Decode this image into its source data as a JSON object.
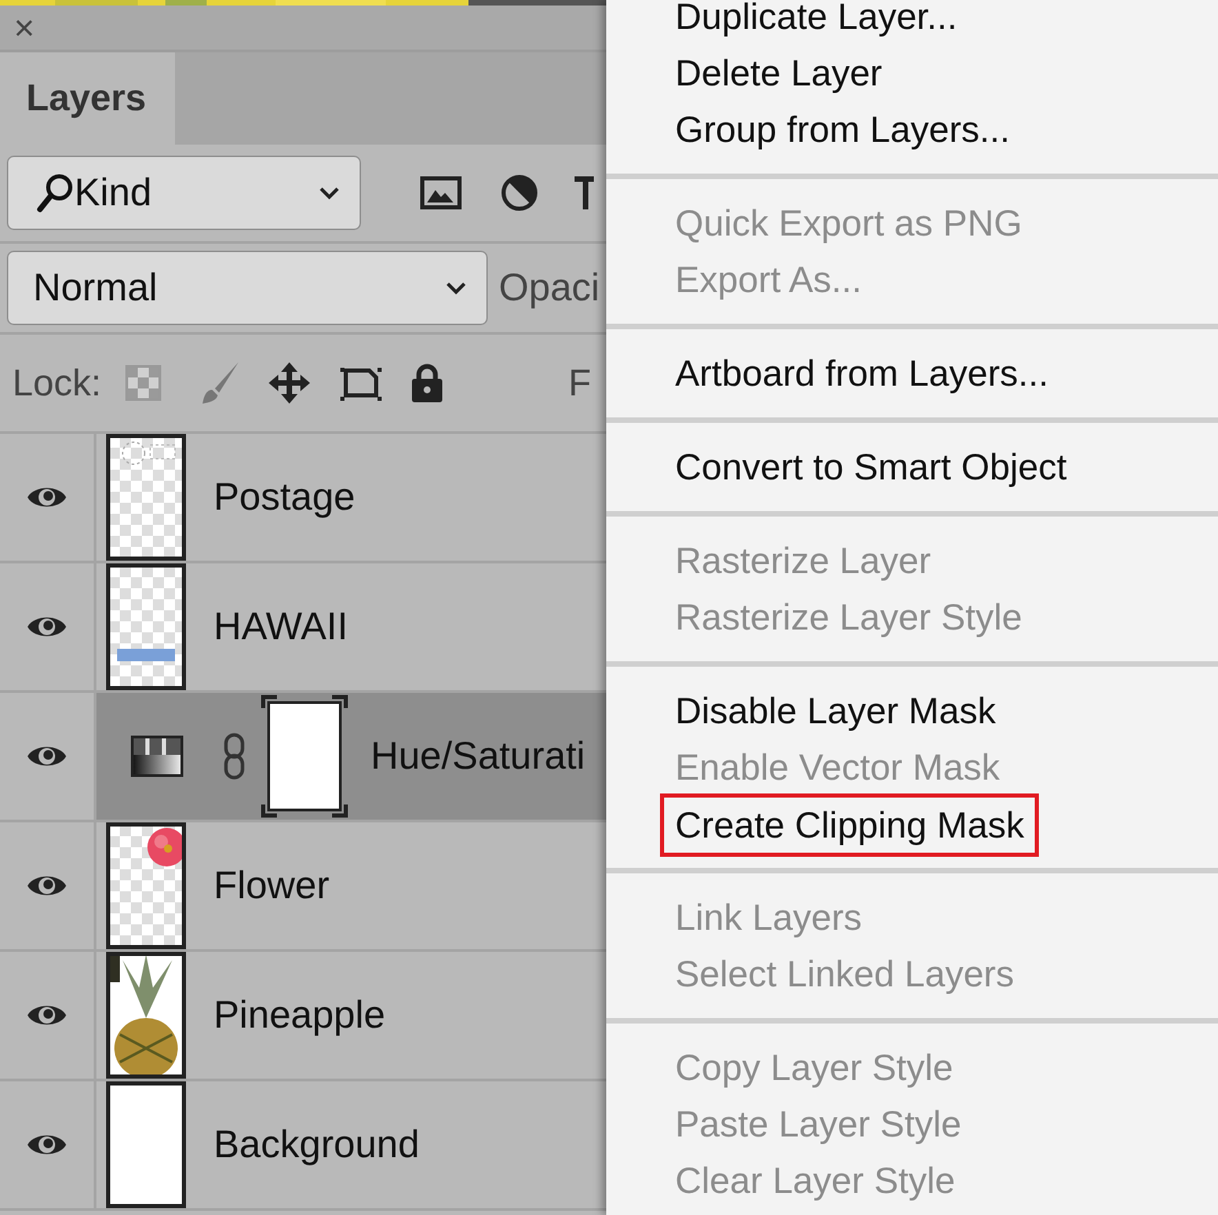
{
  "panel": {
    "close": "×",
    "tab": {
      "label": "Layers",
      "selected": true
    },
    "filter": {
      "value": "Kind"
    },
    "blend_mode": {
      "value": "Normal"
    },
    "opacity_label": "Opaci",
    "lock_label": "Lock:",
    "fill_label": "F"
  },
  "layers": [
    {
      "name": "Postage",
      "visible": true,
      "selected": false,
      "kind": "pixel"
    },
    {
      "name": "HAWAII",
      "visible": true,
      "selected": false,
      "kind": "pixel"
    },
    {
      "name": "Hue/Saturati",
      "visible": true,
      "selected": true,
      "kind": "adjustment"
    },
    {
      "name": "Flower",
      "visible": true,
      "selected": false,
      "kind": "pixel"
    },
    {
      "name": "Pineapple",
      "visible": true,
      "selected": false,
      "kind": "pixel"
    },
    {
      "name": "Background",
      "visible": true,
      "selected": false,
      "kind": "pixel"
    }
  ],
  "context_menu": {
    "groups": [
      [
        {
          "label": "Duplicate Layer...",
          "disabled": false,
          "highlighted": false
        },
        {
          "label": "Delete Layer",
          "disabled": false,
          "highlighted": false
        },
        {
          "label": "Group from Layers...",
          "disabled": false,
          "highlighted": false
        }
      ],
      [
        {
          "label": "Quick Export as PNG",
          "disabled": true,
          "highlighted": false
        },
        {
          "label": "Export As...",
          "disabled": true,
          "highlighted": false
        }
      ],
      [
        {
          "label": "Artboard from Layers...",
          "disabled": false,
          "highlighted": false
        }
      ],
      [
        {
          "label": "Convert to Smart Object",
          "disabled": false,
          "highlighted": false
        }
      ],
      [
        {
          "label": "Rasterize Layer",
          "disabled": true,
          "highlighted": false
        },
        {
          "label": "Rasterize Layer Style",
          "disabled": true,
          "highlighted": false
        }
      ],
      [
        {
          "label": "Disable Layer Mask",
          "disabled": false,
          "highlighted": false
        },
        {
          "label": "Enable Vector Mask",
          "disabled": true,
          "highlighted": false
        },
        {
          "label": "Create Clipping Mask",
          "disabled": false,
          "highlighted": true
        }
      ],
      [
        {
          "label": "Link Layers",
          "disabled": true,
          "highlighted": false
        },
        {
          "label": "Select Linked Layers",
          "disabled": true,
          "highlighted": false
        }
      ],
      [
        {
          "label": "Copy Layer Style",
          "disabled": true,
          "highlighted": false
        },
        {
          "label": "Paste Layer Style",
          "disabled": true,
          "highlighted": false
        },
        {
          "label": "Clear Layer Style",
          "disabled": true,
          "highlighted": false
        }
      ]
    ]
  }
}
